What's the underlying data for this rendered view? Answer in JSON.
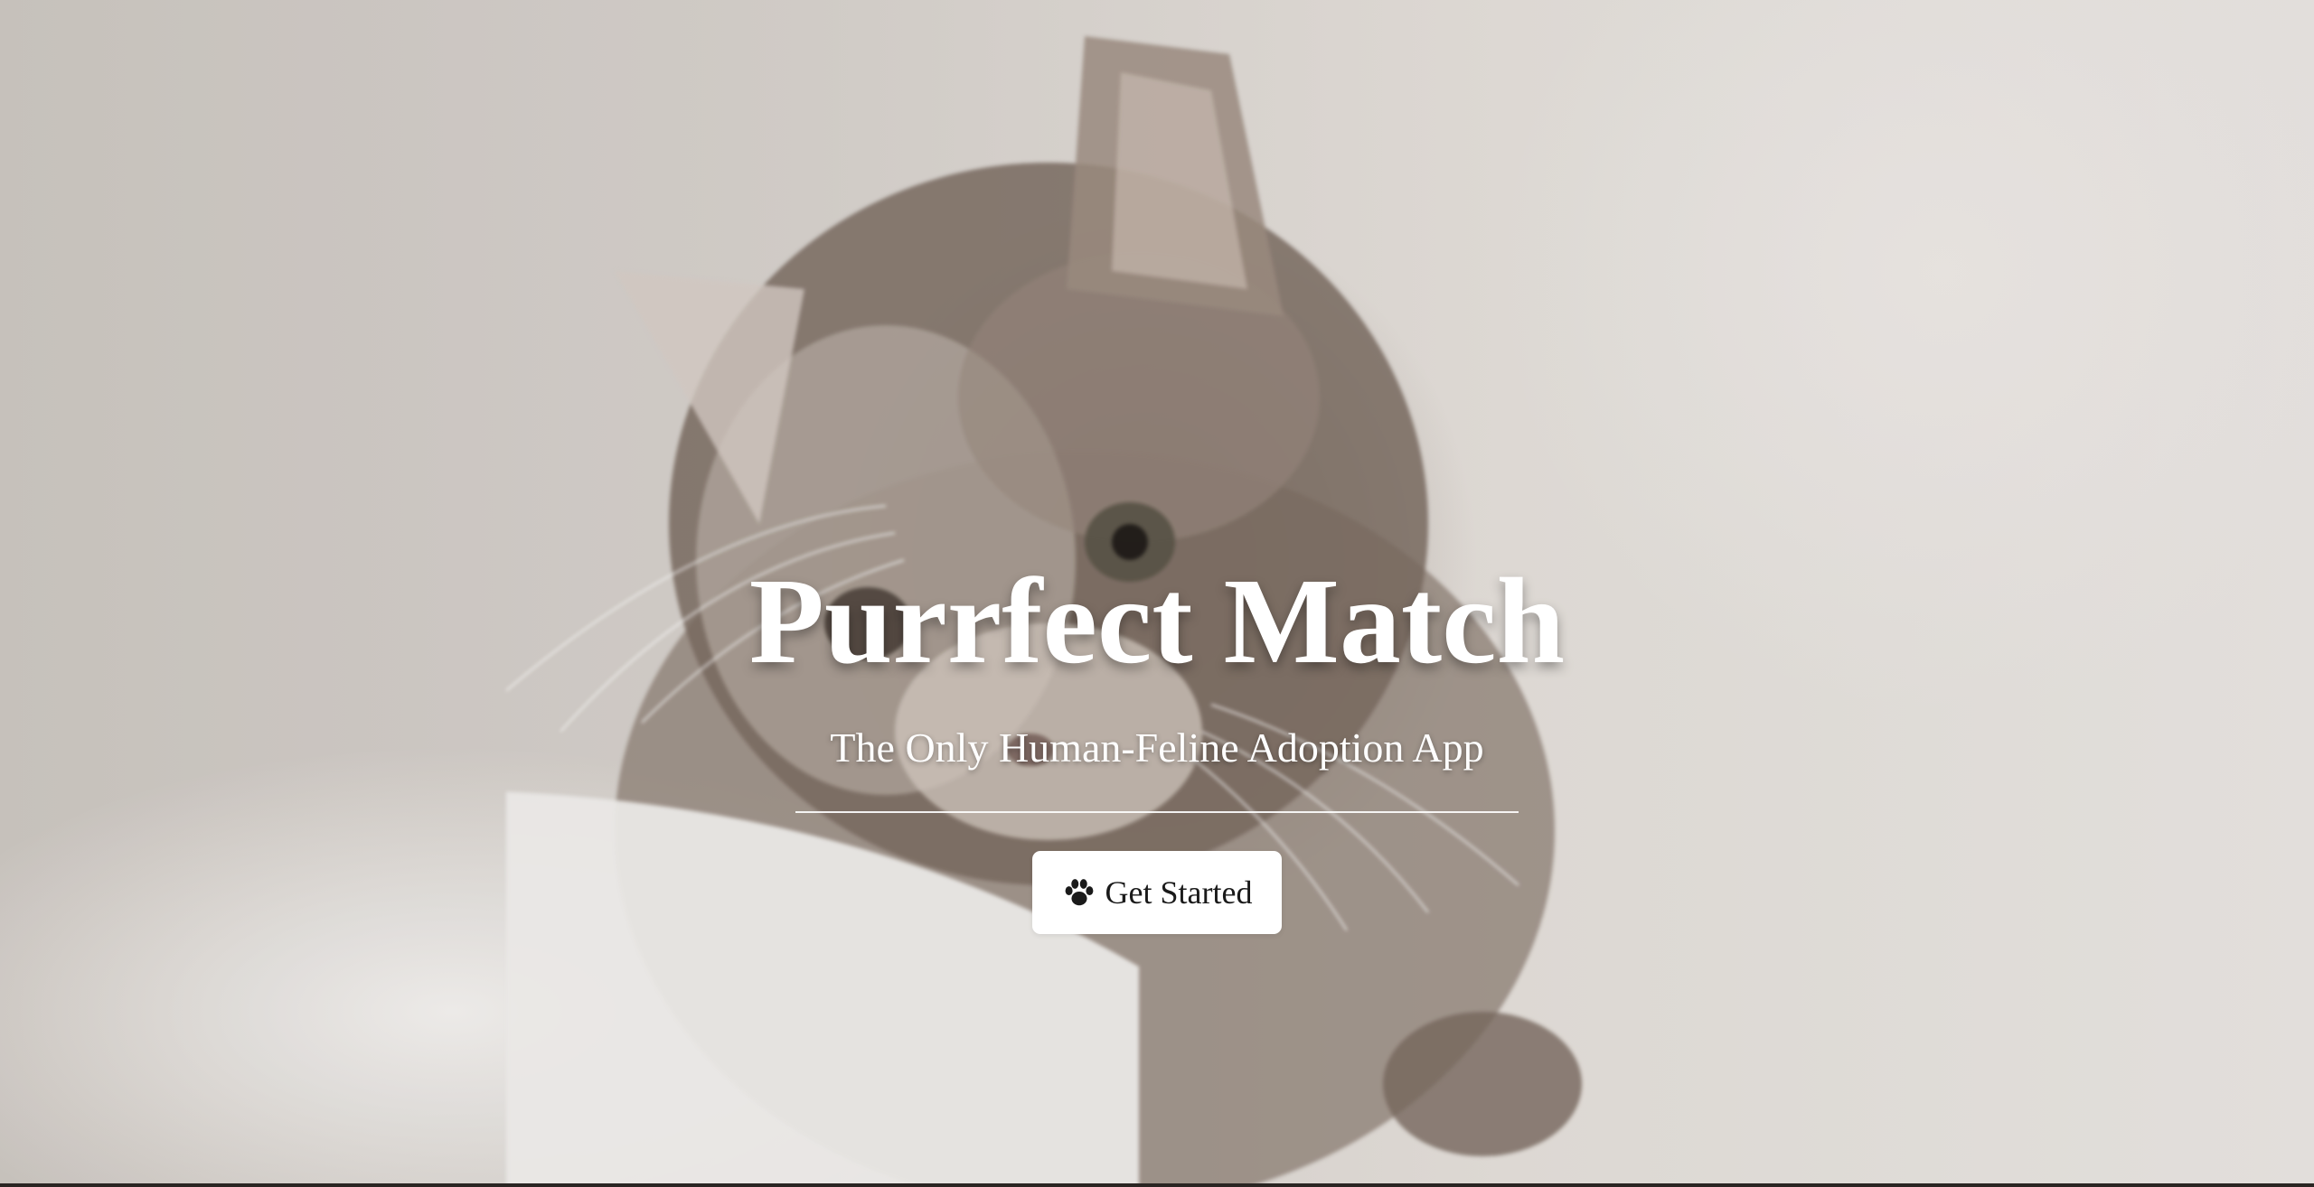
{
  "hero": {
    "title": "Purrfect Match",
    "subtitle": "The Only Human-Feline Adoption App",
    "background_image": "kitten-photo",
    "cta": {
      "label": "Get Started",
      "icon": "paw-icon"
    }
  },
  "colors": {
    "text": "#ffffff",
    "button_bg": "#ffffff",
    "button_text": "#1a1a1a"
  }
}
